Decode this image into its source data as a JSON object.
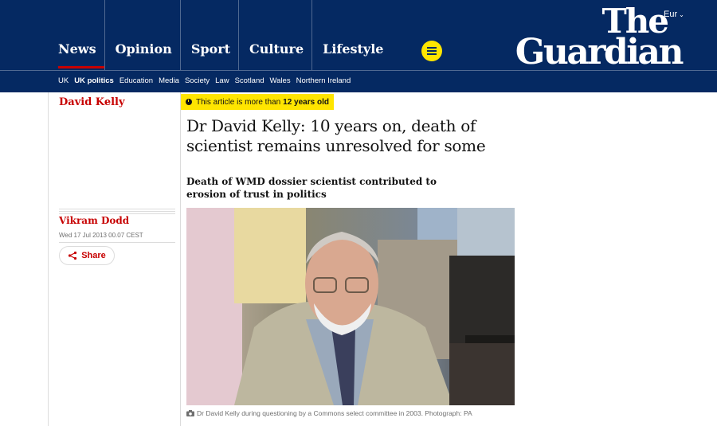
{
  "header": {
    "pillars": [
      "News",
      "Opinion",
      "Sport",
      "Culture",
      "Lifestyle"
    ],
    "edition": "Eur",
    "logo_line1": "The",
    "logo_line2": "Guardian",
    "accent_color": "#c70000",
    "brand_color": "#052962",
    "menu_color": "#ffe500"
  },
  "subnav": {
    "items": [
      "UK",
      "UK politics",
      "Education",
      "Media",
      "Society",
      "Law",
      "Scotland",
      "Wales",
      "Northern Ireland"
    ],
    "active": "UK politics"
  },
  "article": {
    "section": "David Kelly",
    "age_warning_prefix": "This article is more than",
    "age_warning_bold": "12 years old",
    "headline": "Dr David Kelly: 10 years on, death of scientist remains unresolved for some",
    "standfirst": "Death of WMD dossier scientist contributed to erosion of trust in politics",
    "author": "Vikram Dodd",
    "date": "Wed 17 Jul 2013 00.07 CEST",
    "share_label": "Share",
    "caption": "Dr David Kelly during questioning by a Commons select committee in 2003. Photograph: PA",
    "icons": [
      "menu-icon",
      "clock-icon",
      "share-icon",
      "camera-icon",
      "chevron-down-icon"
    ]
  }
}
